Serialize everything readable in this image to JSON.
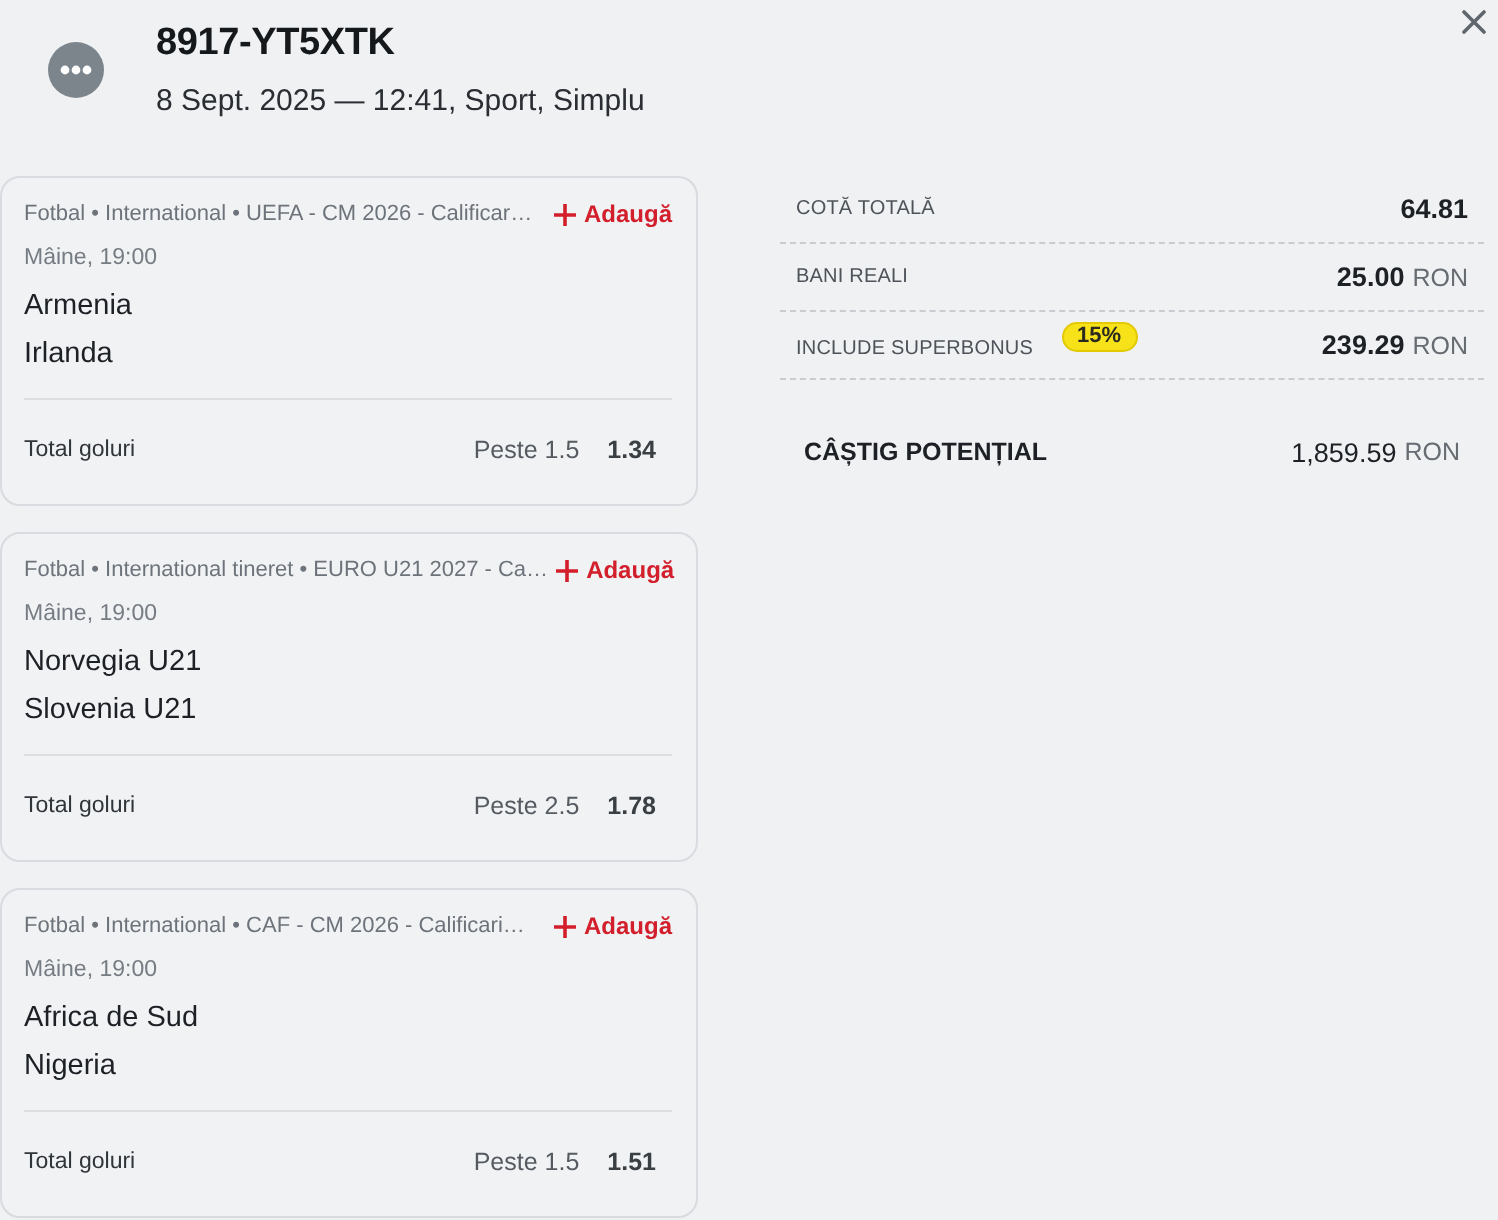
{
  "ticket": {
    "code": "8917-YT5XTK",
    "meta": "8 Sept. 2025 — 12:41, Sport, Simplu"
  },
  "events": [
    {
      "breadcrumb": "Fotbal • International • UEFA - CM 2026 - Calificar…",
      "add_label": "Adaugă",
      "time": "Mâine, 19:00",
      "teams": [
        "Armenia",
        "Irlanda"
      ],
      "market": "Total goluri",
      "selection": "Peste 1.5",
      "odds": "1.34"
    },
    {
      "breadcrumb": "Fotbal • International tineret • EURO U21 2027 - Ca…",
      "add_label": "Adaugă",
      "time": "Mâine, 19:00",
      "teams": [
        "Norvegia U21",
        "Slovenia U21"
      ],
      "market": "Total goluri",
      "selection": "Peste 2.5",
      "odds": "1.78"
    },
    {
      "breadcrumb": "Fotbal • International • CAF - CM 2026 - Calificari…",
      "add_label": "Adaugă",
      "time": "Mâine, 19:00",
      "teams": [
        "Africa de Sud",
        "Nigeria"
      ],
      "market": "Total goluri",
      "selection": "Peste 1.5",
      "odds": "1.51"
    }
  ],
  "summary": {
    "rows": [
      {
        "label": "COTĂ TOTALĂ",
        "value": "64.81"
      },
      {
        "label": "BANI REALI",
        "value": "25.00",
        "currency": "RON"
      },
      {
        "label": "INCLUDE SUPERBONUS",
        "badge": "15%",
        "value": "239.29",
        "currency": "RON"
      }
    ],
    "total": {
      "label": "CÂȘTIG POTENȚIAL",
      "value": "1,859.59",
      "currency": "RON"
    }
  }
}
